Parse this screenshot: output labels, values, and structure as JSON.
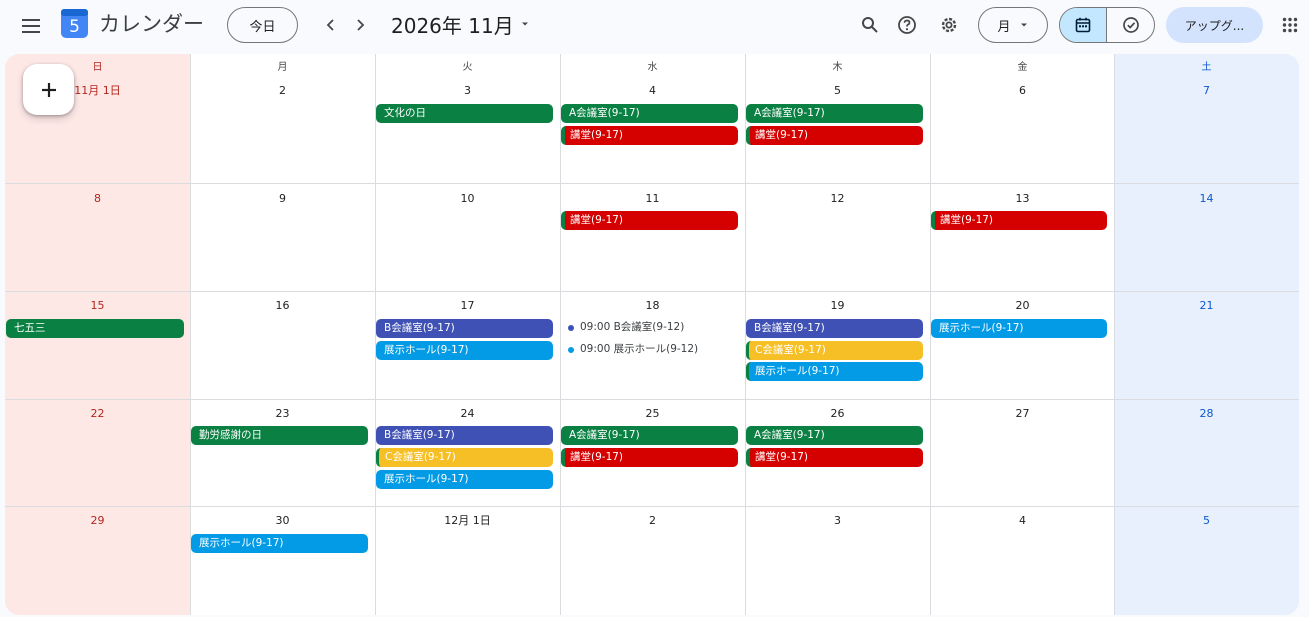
{
  "header": {
    "app_title": "カレンダー",
    "logo_number": "5",
    "today_label": "今日",
    "month_label": "2026年 11月",
    "view_label": "月",
    "upgrade_label": "アップグ...",
    "accent_color": "#c2e7ff"
  },
  "fab": {
    "icon": "plus-icon"
  },
  "weekdays": [
    "日",
    "月",
    "火",
    "水",
    "木",
    "金",
    "土"
  ],
  "weeks": [
    {
      "days": [
        "11月 1日",
        "2",
        "3",
        "4",
        "5",
        "6",
        "7"
      ]
    },
    {
      "days": [
        "8",
        "9",
        "10",
        "11",
        "12",
        "13",
        "14"
      ]
    },
    {
      "days": [
        "15",
        "16",
        "17",
        "18",
        "19",
        "20",
        "21"
      ]
    },
    {
      "days": [
        "22",
        "23",
        "24",
        "25",
        "26",
        "27",
        "28"
      ]
    },
    {
      "days": [
        "29",
        "30",
        "12月 1日",
        "2",
        "3",
        "4",
        "5"
      ]
    }
  ],
  "events": [
    {
      "label": "文化の日",
      "color": "#0b8043"
    },
    {
      "label": "A会議室(9-17)",
      "color": "#0b8043"
    },
    {
      "label": "講堂(9-17)",
      "color": "#d50000"
    },
    {
      "label": "A会議室(9-17)",
      "color": "#0b8043"
    },
    {
      "label": "講堂(9-17)",
      "color": "#d50000"
    },
    {
      "label": "講堂(9-17)",
      "color": "#d50000"
    },
    {
      "label": "講堂(9-17)",
      "color": "#d50000"
    },
    {
      "label": "七五三",
      "color": "#0b8043"
    },
    {
      "label": "B会議室(9-17)",
      "color": "#3f51b5"
    },
    {
      "label": "展示ホール(9-17)",
      "color": "#039be5"
    },
    {
      "label": "09:00 B会議室(9-12)",
      "color": "#3f51b5"
    },
    {
      "label": "09:00 展示ホール(9-12)",
      "color": "#039be5"
    },
    {
      "label": "B会議室(9-17)",
      "color": "#3f51b5"
    },
    {
      "label": "C会議室(9-17)",
      "color": "#f6bf26"
    },
    {
      "label": "展示ホール(9-17)",
      "color": "#039be5"
    },
    {
      "label": "展示ホール(9-17)",
      "color": "#039be5"
    },
    {
      "label": "勤労感謝の日",
      "color": "#0b8043"
    },
    {
      "label": "B会議室(9-17)",
      "color": "#3f51b5"
    },
    {
      "label": "C会議室(9-17)",
      "color": "#f6bf26"
    },
    {
      "label": "展示ホール(9-17)",
      "color": "#039be5"
    },
    {
      "label": "A会議室(9-17)",
      "color": "#0b8043"
    },
    {
      "label": "講堂(9-17)",
      "color": "#d50000"
    },
    {
      "label": "A会議室(9-17)",
      "color": "#0b8043"
    },
    {
      "label": "講堂(9-17)",
      "color": "#d50000"
    },
    {
      "label": "展示ホール(9-17)",
      "color": "#039be5"
    }
  ]
}
